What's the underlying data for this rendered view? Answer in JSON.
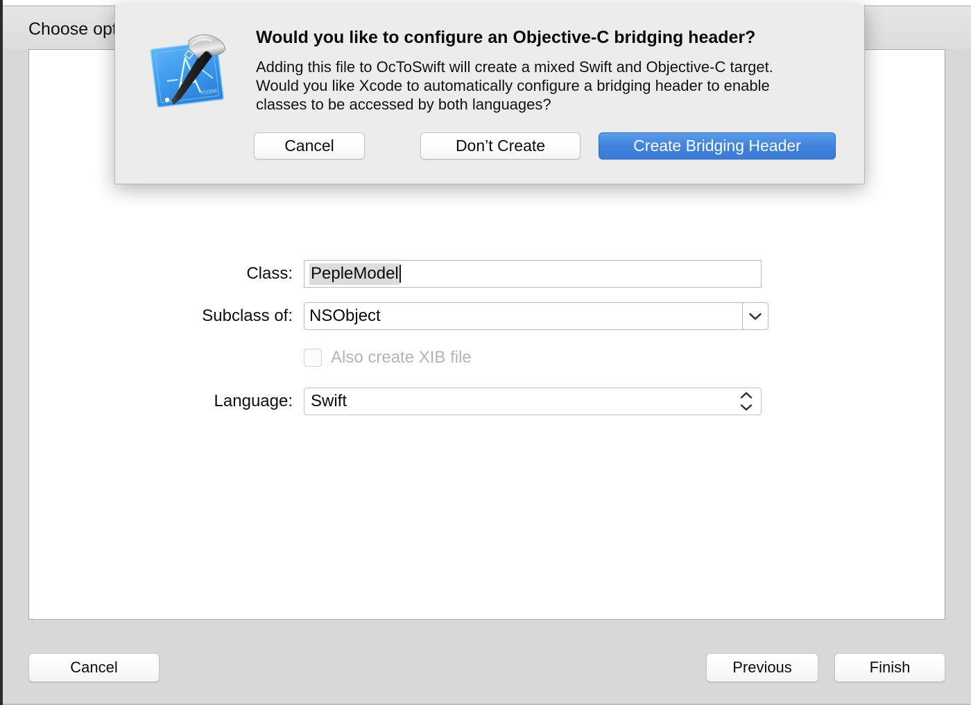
{
  "window": {
    "page_title": "Choose options for your new file:"
  },
  "form": {
    "class": {
      "label": "Class:",
      "value": "PepleModel"
    },
    "subclass": {
      "label": "Subclass of:",
      "value": "NSObject",
      "arrow_icon": "chevron-down-icon"
    },
    "xib": {
      "label": "Also create XIB file",
      "checked": false,
      "enabled": false
    },
    "language": {
      "label": "Language:",
      "value": "Swift",
      "stepper_icon": "chevron-up-down-icon"
    }
  },
  "footer": {
    "cancel_label": "Cancel",
    "previous_label": "Previous",
    "finish_label": "Finish"
  },
  "sheet": {
    "icon": "xcode-app-icon",
    "title": "Would you like to configure an Objective-C bridging header?",
    "body_line1": "Adding this file to OcToSwift will create a mixed Swift and Objective-C target.",
    "body_line2": "Would you like Xcode to automatically configure a bridging header to enable",
    "body_line3": "classes to be accessed by both languages?",
    "cancel_label": "Cancel",
    "dont_create_label": "Don’t Create",
    "create_label": "Create Bridging Header"
  },
  "colors": {
    "accent_blue": "#3f83dd",
    "window_gray": "#d8d8d8",
    "sheet_gray": "#ececec",
    "selection_gray": "#dcdcdc",
    "disabled_gray": "#b4b4b4"
  }
}
